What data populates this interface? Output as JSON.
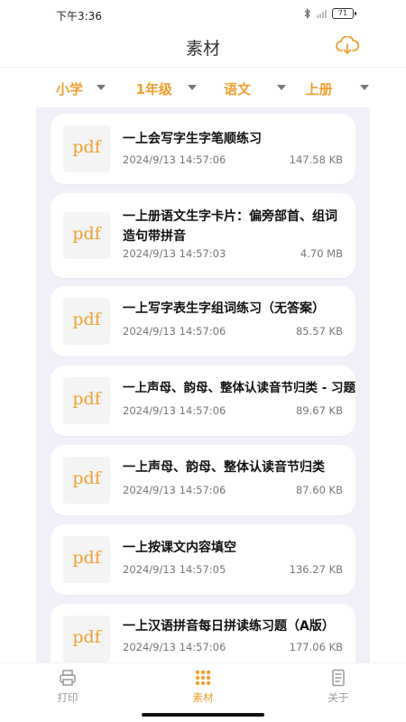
{
  "status": {
    "time": "下午3:36",
    "battery": "71"
  },
  "header": {
    "title": "素材",
    "cloud_icon": "cloud-download-icon"
  },
  "filters": [
    {
      "label": "小学"
    },
    {
      "label": "1年级"
    },
    {
      "label": "语文"
    },
    {
      "label": "上册"
    }
  ],
  "files": [
    {
      "thumb": "pdf",
      "title": "一上会写字生字笔顺练习",
      "time": "2024/9/13 14:57:06",
      "size": "147.58 KB"
    },
    {
      "thumb": "pdf",
      "title": "一上册语文生字卡片：偏旁部首、组词造句带拼音",
      "time": "2024/9/13 14:57:03",
      "size": "4.70 MB"
    },
    {
      "thumb": "pdf",
      "title": "一上写字表生字组词练习（无答案）",
      "time": "2024/9/13 14:57:06",
      "size": "85.57 KB"
    },
    {
      "thumb": "pdf",
      "title": "一上声母、韵母、整体认读音节归类 - 习题",
      "time": "2024/9/13 14:57:06",
      "size": "89.67 KB"
    },
    {
      "thumb": "pdf",
      "title": "一上声母、韵母、整体认读音节归类",
      "time": "2024/9/13 14:57:06",
      "size": "87.60 KB"
    },
    {
      "thumb": "pdf",
      "title": "一上按课文内容填空",
      "time": "2024/9/13 14:57:05",
      "size": "136.27 KB"
    },
    {
      "thumb": "pdf",
      "title": "一上汉语拼音每日拼读练习题（A版）",
      "time": "2024/9/13 14:57:06",
      "size": "177.06 KB"
    }
  ],
  "tabs": [
    {
      "label": "打印",
      "icon": "printer-icon"
    },
    {
      "label": "素材",
      "icon": "grid-icon"
    },
    {
      "label": "关于",
      "icon": "document-icon"
    }
  ],
  "colors": {
    "accent": "#f0a030",
    "list_bg": "#f0f0f8"
  }
}
